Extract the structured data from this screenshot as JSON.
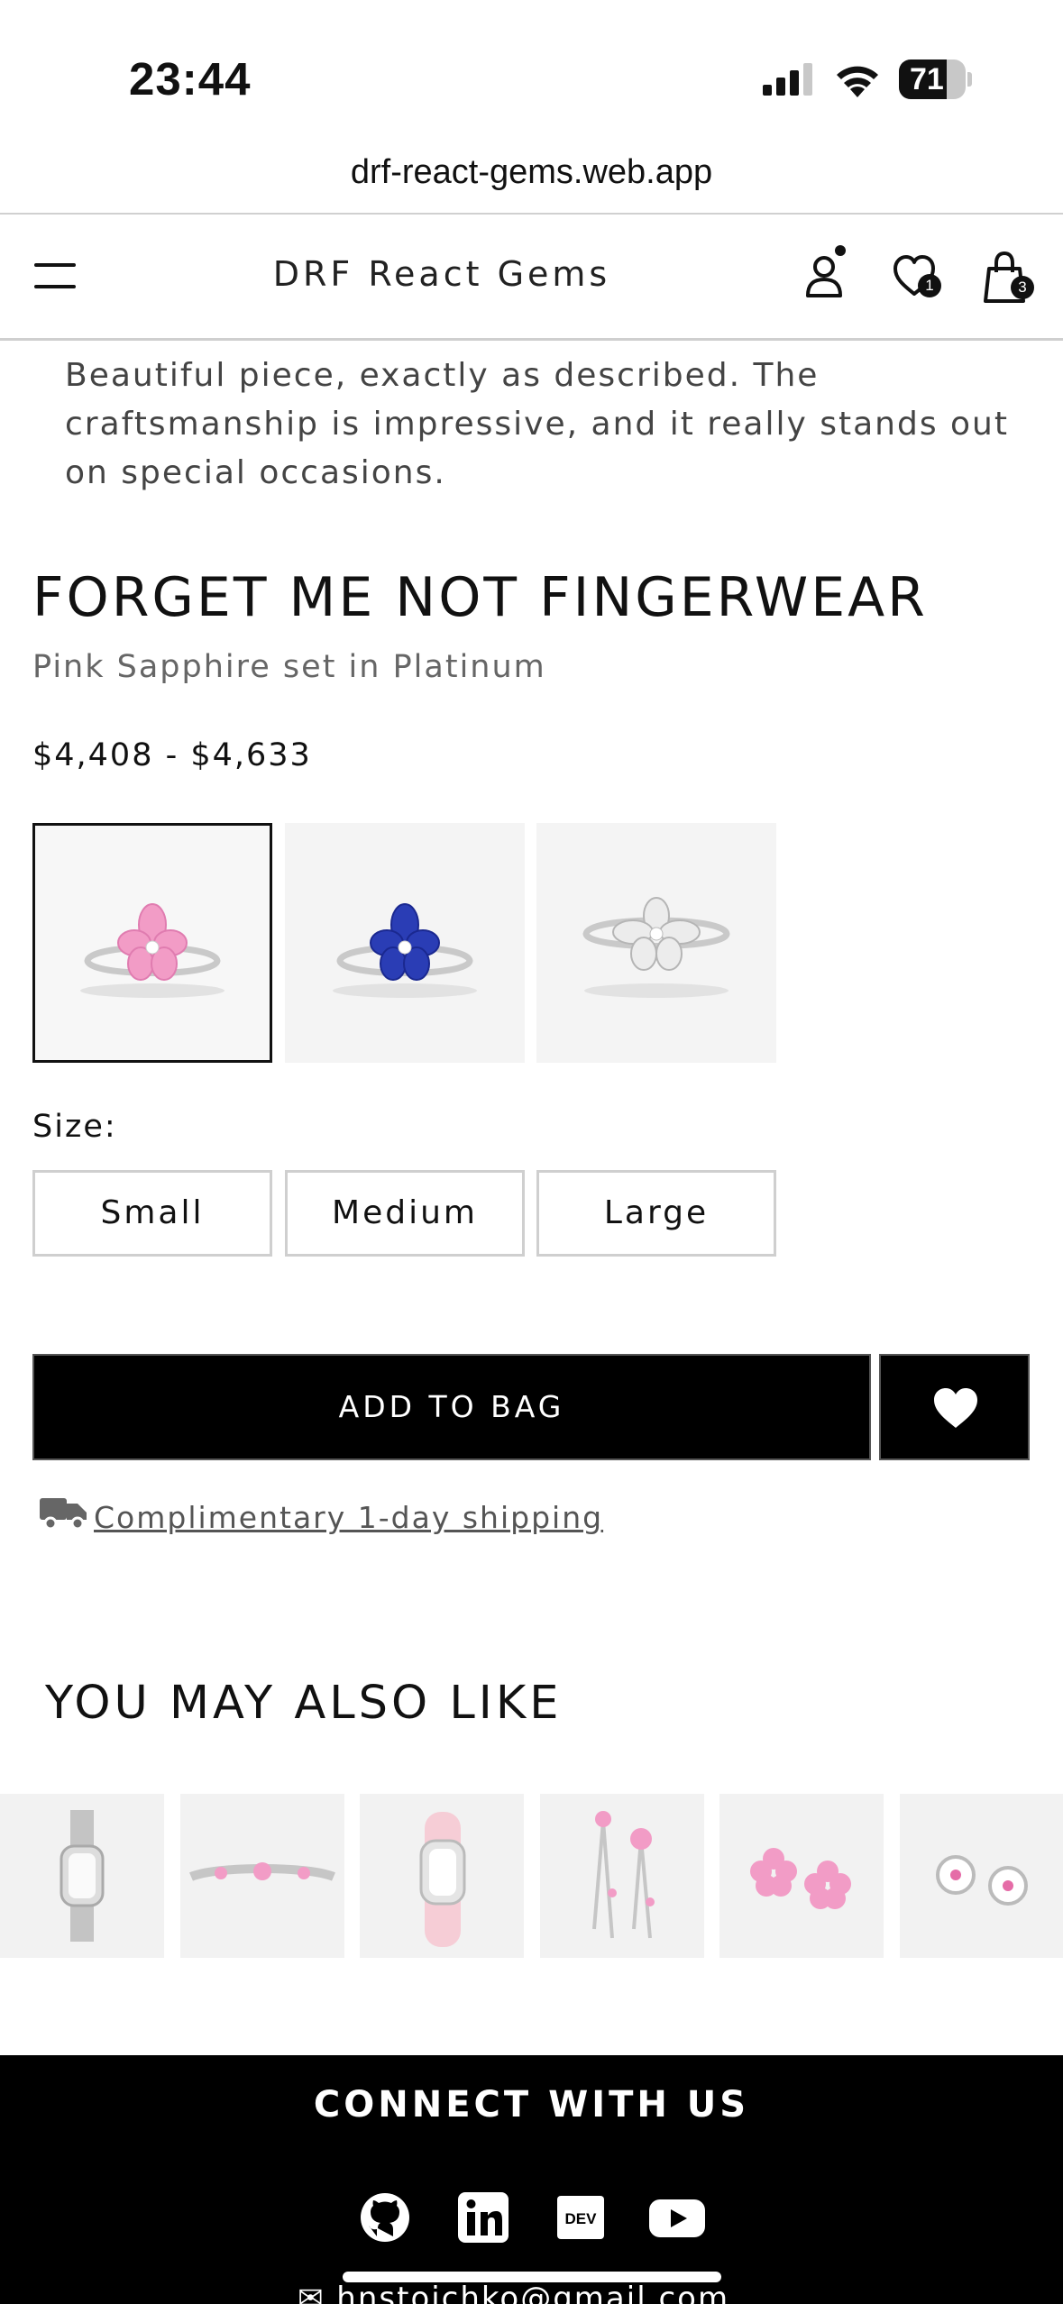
{
  "status_bar": {
    "time": "23:44",
    "battery": "71",
    "battery_level": 0.71
  },
  "browser": {
    "url": "drf-react-gems.web.app"
  },
  "header": {
    "brand": "DRF React Gems",
    "icons": [
      "menu-icon",
      "user-icon",
      "heart-icon",
      "bag-icon"
    ],
    "wishlist_count": "1",
    "bag_count": "3"
  },
  "review": {
    "text": "Beautiful piece, exactly as described. The craftsmanship is impressive, and it really stands out on special occasions."
  },
  "product": {
    "title": "FORGET ME NOT FINGERWEAR",
    "subtitle": "Pink Sapphire set in Platinum",
    "price_range": "$4,408 - $4,633",
    "variants": [
      {
        "stone": "pink",
        "color": "#f29cc6",
        "selected": true
      },
      {
        "stone": "blue",
        "color": "#2a3db5",
        "selected": false
      },
      {
        "stone": "white",
        "color": "#e6e6e6",
        "selected": false
      }
    ],
    "size_label": "Size:",
    "sizes": [
      "Small",
      "Medium",
      "Large"
    ],
    "add_to_bag": "ADD TO BAG",
    "shipping": "Complimentary 1-day shipping"
  },
  "recommendations": {
    "heading": "YOU MAY ALSO LIKE",
    "items": [
      "silver-watch",
      "pink-bracelet",
      "pink-strap-watch",
      "pink-drop-earrings",
      "pink-flower-earrings",
      "pink-clover-earrings"
    ]
  },
  "footer": {
    "heading": "CONNECT WITH US",
    "social": [
      "github-icon",
      "linkedin-icon",
      "dev-icon",
      "youtube-icon"
    ],
    "email_partial": "✉ hnstoichko@gmail.com"
  },
  "colors": {
    "accent": "#000000",
    "pink": "#f29cc6",
    "blue": "#2a3db5",
    "border": "#cfcfcf"
  }
}
